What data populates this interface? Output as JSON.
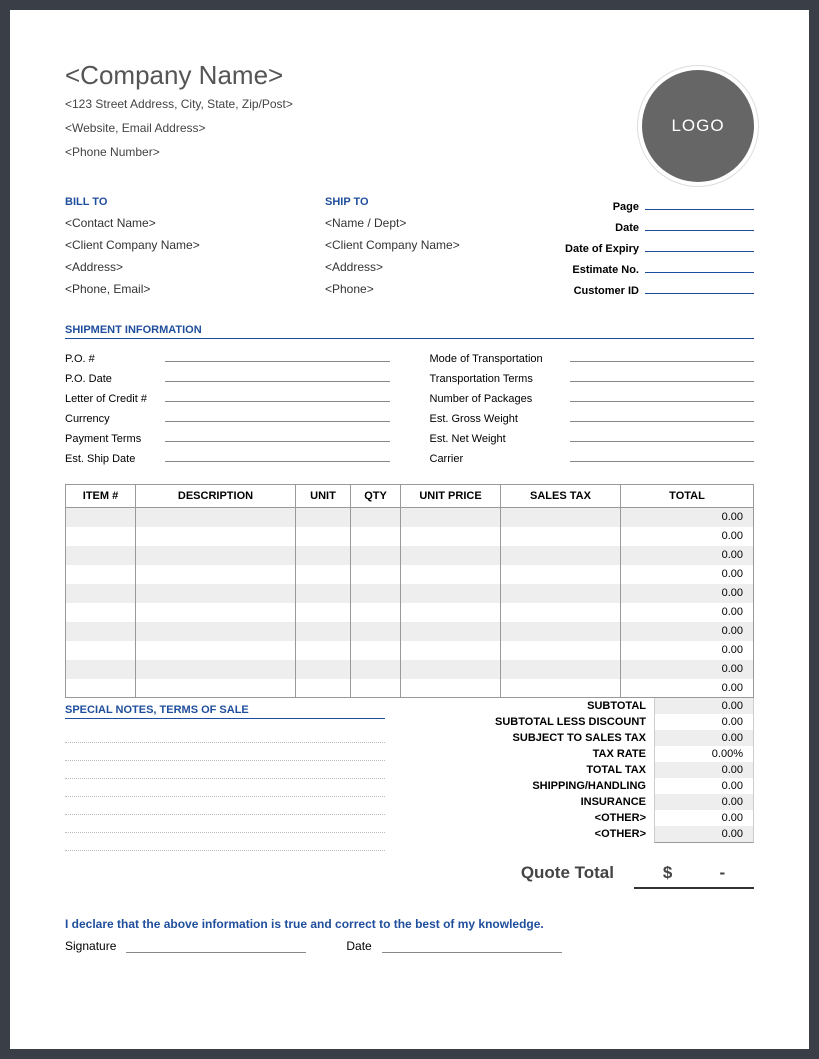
{
  "header": {
    "company_name": "<Company Name>",
    "address_line": "<123 Street Address, City, State, Zip/Post>",
    "web_email": "<Website, Email Address>",
    "phone": "<Phone Number>",
    "logo_text": "LOGO"
  },
  "bill_to": {
    "heading": "BILL TO",
    "contact": "<Contact Name>",
    "company": "<Client Company Name>",
    "address": "<Address>",
    "phone_email": "<Phone, Email>"
  },
  "ship_to": {
    "heading": "SHIP TO",
    "name": "<Name / Dept>",
    "company": "<Client Company Name>",
    "address": "<Address>",
    "phone": "<Phone>"
  },
  "meta": {
    "page": "Page",
    "date": "Date",
    "expiry": "Date of Expiry",
    "estimate": "Estimate No.",
    "customer": "Customer ID"
  },
  "shipment": {
    "heading": "SHIPMENT INFORMATION",
    "left": {
      "po": "P.O. #",
      "podate": "P.O. Date",
      "loc": "Letter of Credit #",
      "currency": "Currency",
      "payterms": "Payment Terms",
      "shipdate": "Est. Ship Date"
    },
    "right": {
      "mode": "Mode of Transportation",
      "terms": "Transportation Terms",
      "pkgs": "Number of Packages",
      "gross": "Est. Gross Weight",
      "net": "Est. Net Weight",
      "carrier": "Carrier"
    }
  },
  "table": {
    "headers": {
      "item": "ITEM #",
      "desc": "DESCRIPTION",
      "unit": "UNIT",
      "qty": "QTY",
      "price": "UNIT PRICE",
      "tax": "SALES TAX",
      "total": "TOTAL"
    },
    "rows": [
      {
        "total": "0.00"
      },
      {
        "total": "0.00"
      },
      {
        "total": "0.00"
      },
      {
        "total": "0.00"
      },
      {
        "total": "0.00"
      },
      {
        "total": "0.00"
      },
      {
        "total": "0.00"
      },
      {
        "total": "0.00"
      },
      {
        "total": "0.00"
      },
      {
        "total": "0.00"
      }
    ]
  },
  "notes_heading": "SPECIAL NOTES, TERMS OF SALE",
  "totals": {
    "subtotal": {
      "label": "SUBTOTAL",
      "val": "0.00"
    },
    "discount": {
      "label": "SUBTOTAL LESS DISCOUNT",
      "val": "0.00"
    },
    "subject": {
      "label": "SUBJECT TO SALES TAX",
      "val": "0.00"
    },
    "rate": {
      "label": "TAX RATE",
      "val": "0.00%"
    },
    "tax": {
      "label": "TOTAL TAX",
      "val": "0.00"
    },
    "shipping": {
      "label": "SHIPPING/HANDLING",
      "val": "0.00"
    },
    "insurance": {
      "label": "INSURANCE",
      "val": "0.00"
    },
    "other1": {
      "label": "<OTHER>",
      "val": "0.00"
    },
    "other2": {
      "label": "<OTHER>",
      "val": "0.00"
    }
  },
  "quote": {
    "label": "Quote Total",
    "currency": "$",
    "amount": "-"
  },
  "declaration": "I declare that the above information is true and correct to the best of my knowledge.",
  "signature_label": "Signature",
  "date_label": "Date"
}
